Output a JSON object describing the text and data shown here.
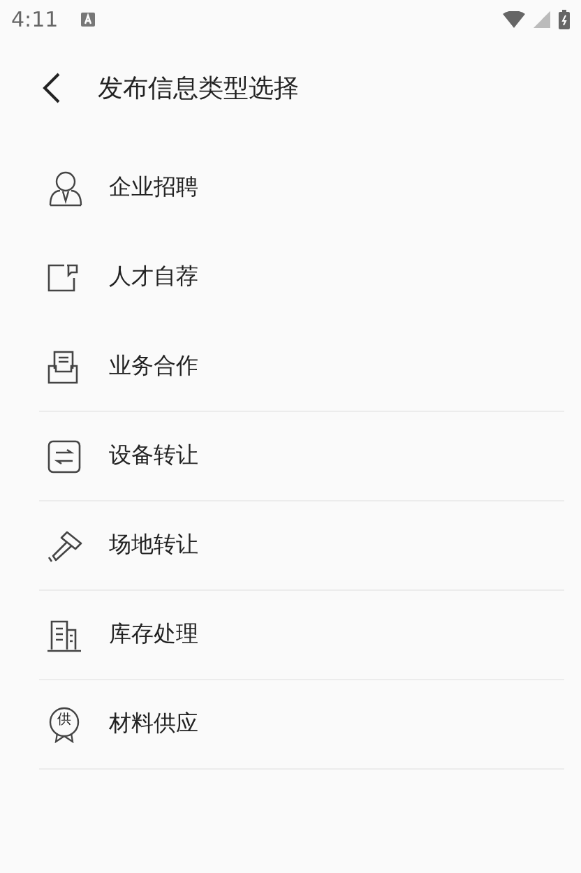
{
  "status_bar": {
    "time": "4:11"
  },
  "header": {
    "title": "发布信息类型选择"
  },
  "items": [
    {
      "label": "企业招聘",
      "divider": false
    },
    {
      "label": "人才自荐",
      "divider": false
    },
    {
      "label": "业务合作",
      "divider": true
    },
    {
      "label": "设备转让",
      "divider": true
    },
    {
      "label": "场地转让",
      "divider": true
    },
    {
      "label": "库存处理",
      "divider": true
    },
    {
      "label": "材料供应",
      "badge": "供",
      "divider": true
    }
  ]
}
